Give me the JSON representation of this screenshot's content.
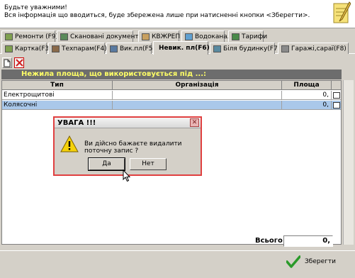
{
  "info": {
    "line1": "Будьте уважними!",
    "line2": "Вся інформація що вводиться, буде збережена лише при натисненні кнопки <Зберегти>."
  },
  "tabs_row1": [
    {
      "label": "Ремонти (F9)",
      "icon": "repair-icon"
    },
    {
      "label": "Скановані документи",
      "icon": "scan-icon"
    },
    {
      "label": "КВЖРЕП",
      "icon": "building-icon"
    },
    {
      "label": "Водоканал",
      "icon": "water-icon"
    },
    {
      "label": "Тарифи",
      "icon": "tariff-icon"
    }
  ],
  "tabs_row2": [
    {
      "label": "Картка(F3)",
      "icon": "card-icon"
    },
    {
      "label": "Техпарам(F4)",
      "icon": "tech-icon"
    },
    {
      "label": "Вик.пл(F5)",
      "icon": "area-icon"
    },
    {
      "label": "Невик. пл(F6)",
      "icon": "no-entry-icon",
      "active": true
    },
    {
      "label": "Біля будинку(F7)",
      "icon": "house-icon"
    },
    {
      "label": "Гаражі,сараї(F8)",
      "icon": "garage-icon"
    }
  ],
  "panel_title": "Нежила площа, що використовується під ...:",
  "grid": {
    "headers": [
      "Тип",
      "Організація",
      "Площа",
      ""
    ],
    "rows": [
      {
        "type": "Електрощитові",
        "org": "",
        "area": "0,"
      },
      {
        "type": "Колясочні",
        "org": "",
        "area": "0,"
      }
    ]
  },
  "total": {
    "label": "Всього:",
    "value": "0,"
  },
  "save_label": "Зберегти",
  "dialog": {
    "title": "УВАГА !!!",
    "message": "Ви дійсно бажаєте видалити поточну запис ?",
    "yes": "Да",
    "no": "Нет"
  },
  "colors": {
    "accent_title_text": "#ffff66",
    "selected_row": "#aac8ea",
    "dialog_border": "#e04040"
  }
}
